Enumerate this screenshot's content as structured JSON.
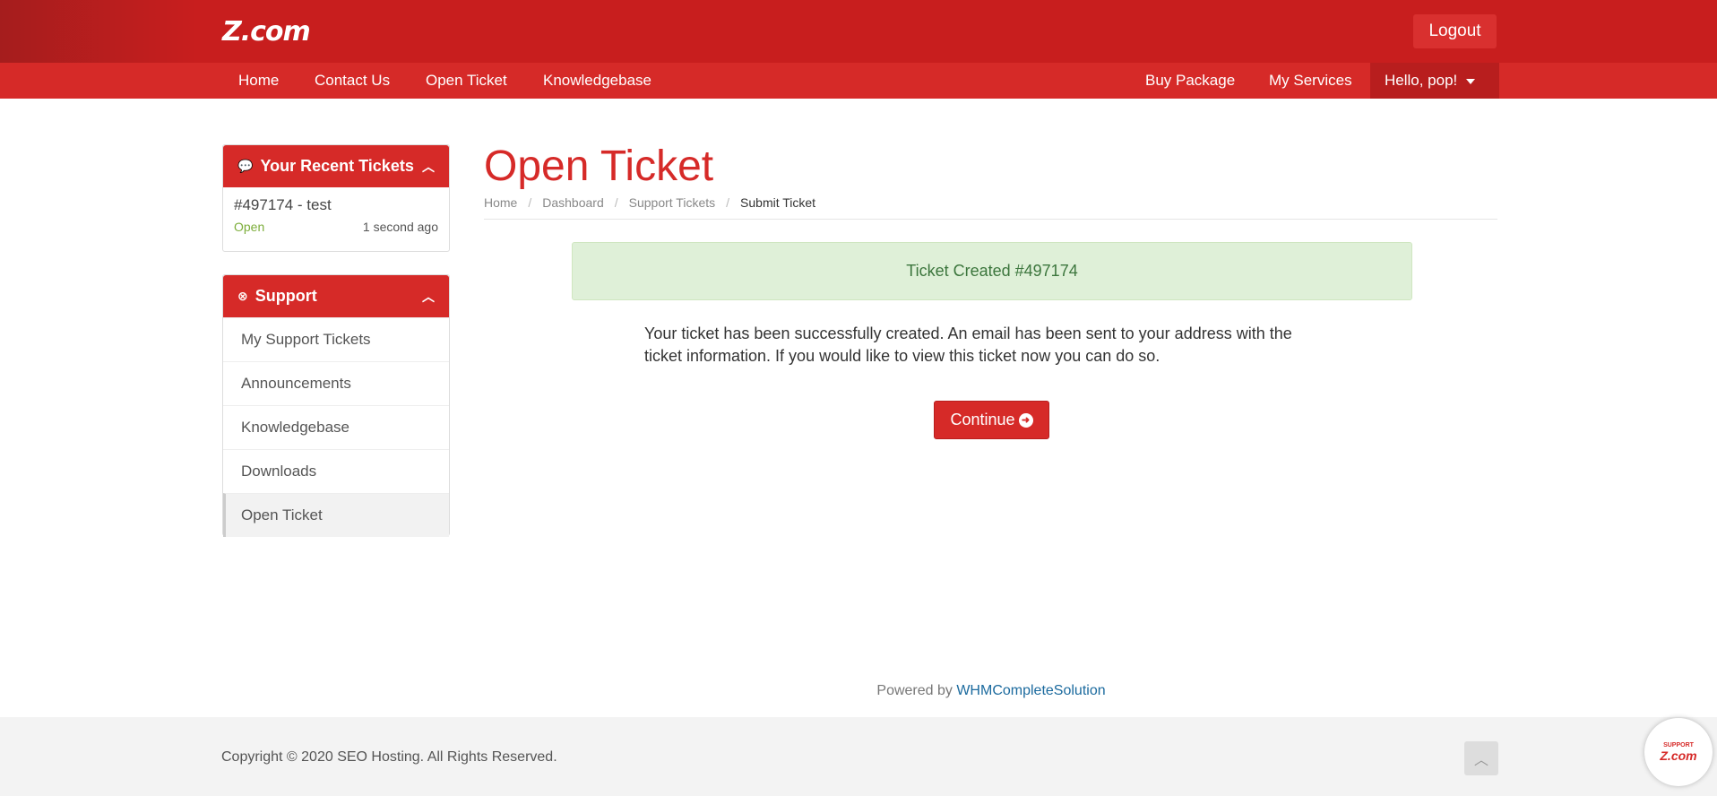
{
  "header": {
    "logo_text": "Z.com",
    "logout_label": "Logout"
  },
  "nav": {
    "left": [
      "Home",
      "Contact Us",
      "Open Ticket",
      "Knowledgebase"
    ],
    "right": [
      "Buy Package",
      "My Services"
    ],
    "user_label": "Hello, pop!"
  },
  "sidebar": {
    "recent_tickets": {
      "title": "Your Recent Tickets",
      "ticket_title": "#497174 - test",
      "ticket_status": "Open",
      "ticket_time": "1 second ago"
    },
    "support": {
      "title": "Support",
      "items": [
        "My Support Tickets",
        "Announcements",
        "Knowledgebase",
        "Downloads",
        "Open Ticket"
      ]
    }
  },
  "main": {
    "page_title": "Open Ticket",
    "breadcrumb": [
      "Home",
      "Dashboard",
      "Support Tickets",
      "Submit Ticket"
    ],
    "alert_text": "Ticket Created #497174",
    "message": "Your ticket has been successfully created. An email has been sent to your address with the ticket information. If you would like to view this ticket now you can do so.",
    "continue_label": "Continue"
  },
  "powered": {
    "prefix": "Powered by ",
    "link": "WHMCompleteSolution"
  },
  "footer": {
    "copyright": "Copyright © 2020 SEO Hosting. All Rights Reserved."
  },
  "widget": {
    "small": "SUPPORT",
    "logo": "Z.com"
  },
  "colors": {
    "brand_red": "#d62a28",
    "success_bg": "#dff0d8",
    "success_text": "#3c763d"
  }
}
